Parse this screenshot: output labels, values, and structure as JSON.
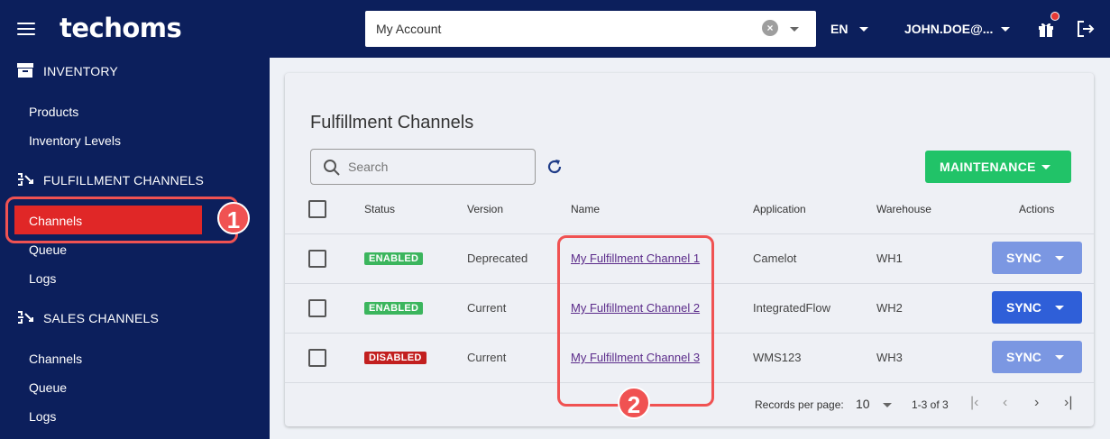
{
  "header": {
    "logo": "techoms",
    "account": "My Account",
    "language": "EN",
    "user": "JOHN.DOE@..."
  },
  "sidebar": {
    "sections": [
      {
        "label": "INVENTORY",
        "items": [
          "Products",
          "Inventory Levels"
        ]
      },
      {
        "label": "FULFILLMENT CHANNELS",
        "items": [
          "Channels",
          "Queue",
          "Logs"
        ]
      },
      {
        "label": "SALES CHANNELS",
        "items": [
          "Channels",
          "Queue",
          "Logs"
        ]
      }
    ]
  },
  "callouts": {
    "first": "1",
    "second": "2"
  },
  "main": {
    "title": "Fulfillment Channels",
    "search_placeholder": "Search",
    "maintenance_label": "MAINTENANCE",
    "columns": [
      "Status",
      "Version",
      "Name",
      "Application",
      "Warehouse",
      "Actions"
    ],
    "rows": [
      {
        "status": "ENABLED",
        "version": "Deprecated",
        "name": "My Fulfillment Channel 1",
        "application": "Camelot",
        "warehouse": "WH1",
        "action": "SYNC"
      },
      {
        "status": "ENABLED",
        "version": "Current",
        "name": "My Fulfillment Channel 2",
        "application": "IntegratedFlow",
        "warehouse": "WH2",
        "action": "SYNC"
      },
      {
        "status": "DISABLED",
        "version": "Current",
        "name": "My Fulfillment Channel 3",
        "application": "WMS123",
        "warehouse": "WH3",
        "action": "SYNC"
      }
    ],
    "footer": {
      "records_label": "Records per page:",
      "per_page": "10",
      "range": "1-3 of 3"
    }
  },
  "colors": {
    "navy": "#0c1f5c",
    "active_red": "#e02727",
    "callout": "#f05252",
    "green": "#21c368",
    "enabled": "#3bb55d",
    "disabled": "#c21f1f",
    "sync_dark": "#2f5fd8",
    "sync_light": "#7b97e2"
  }
}
